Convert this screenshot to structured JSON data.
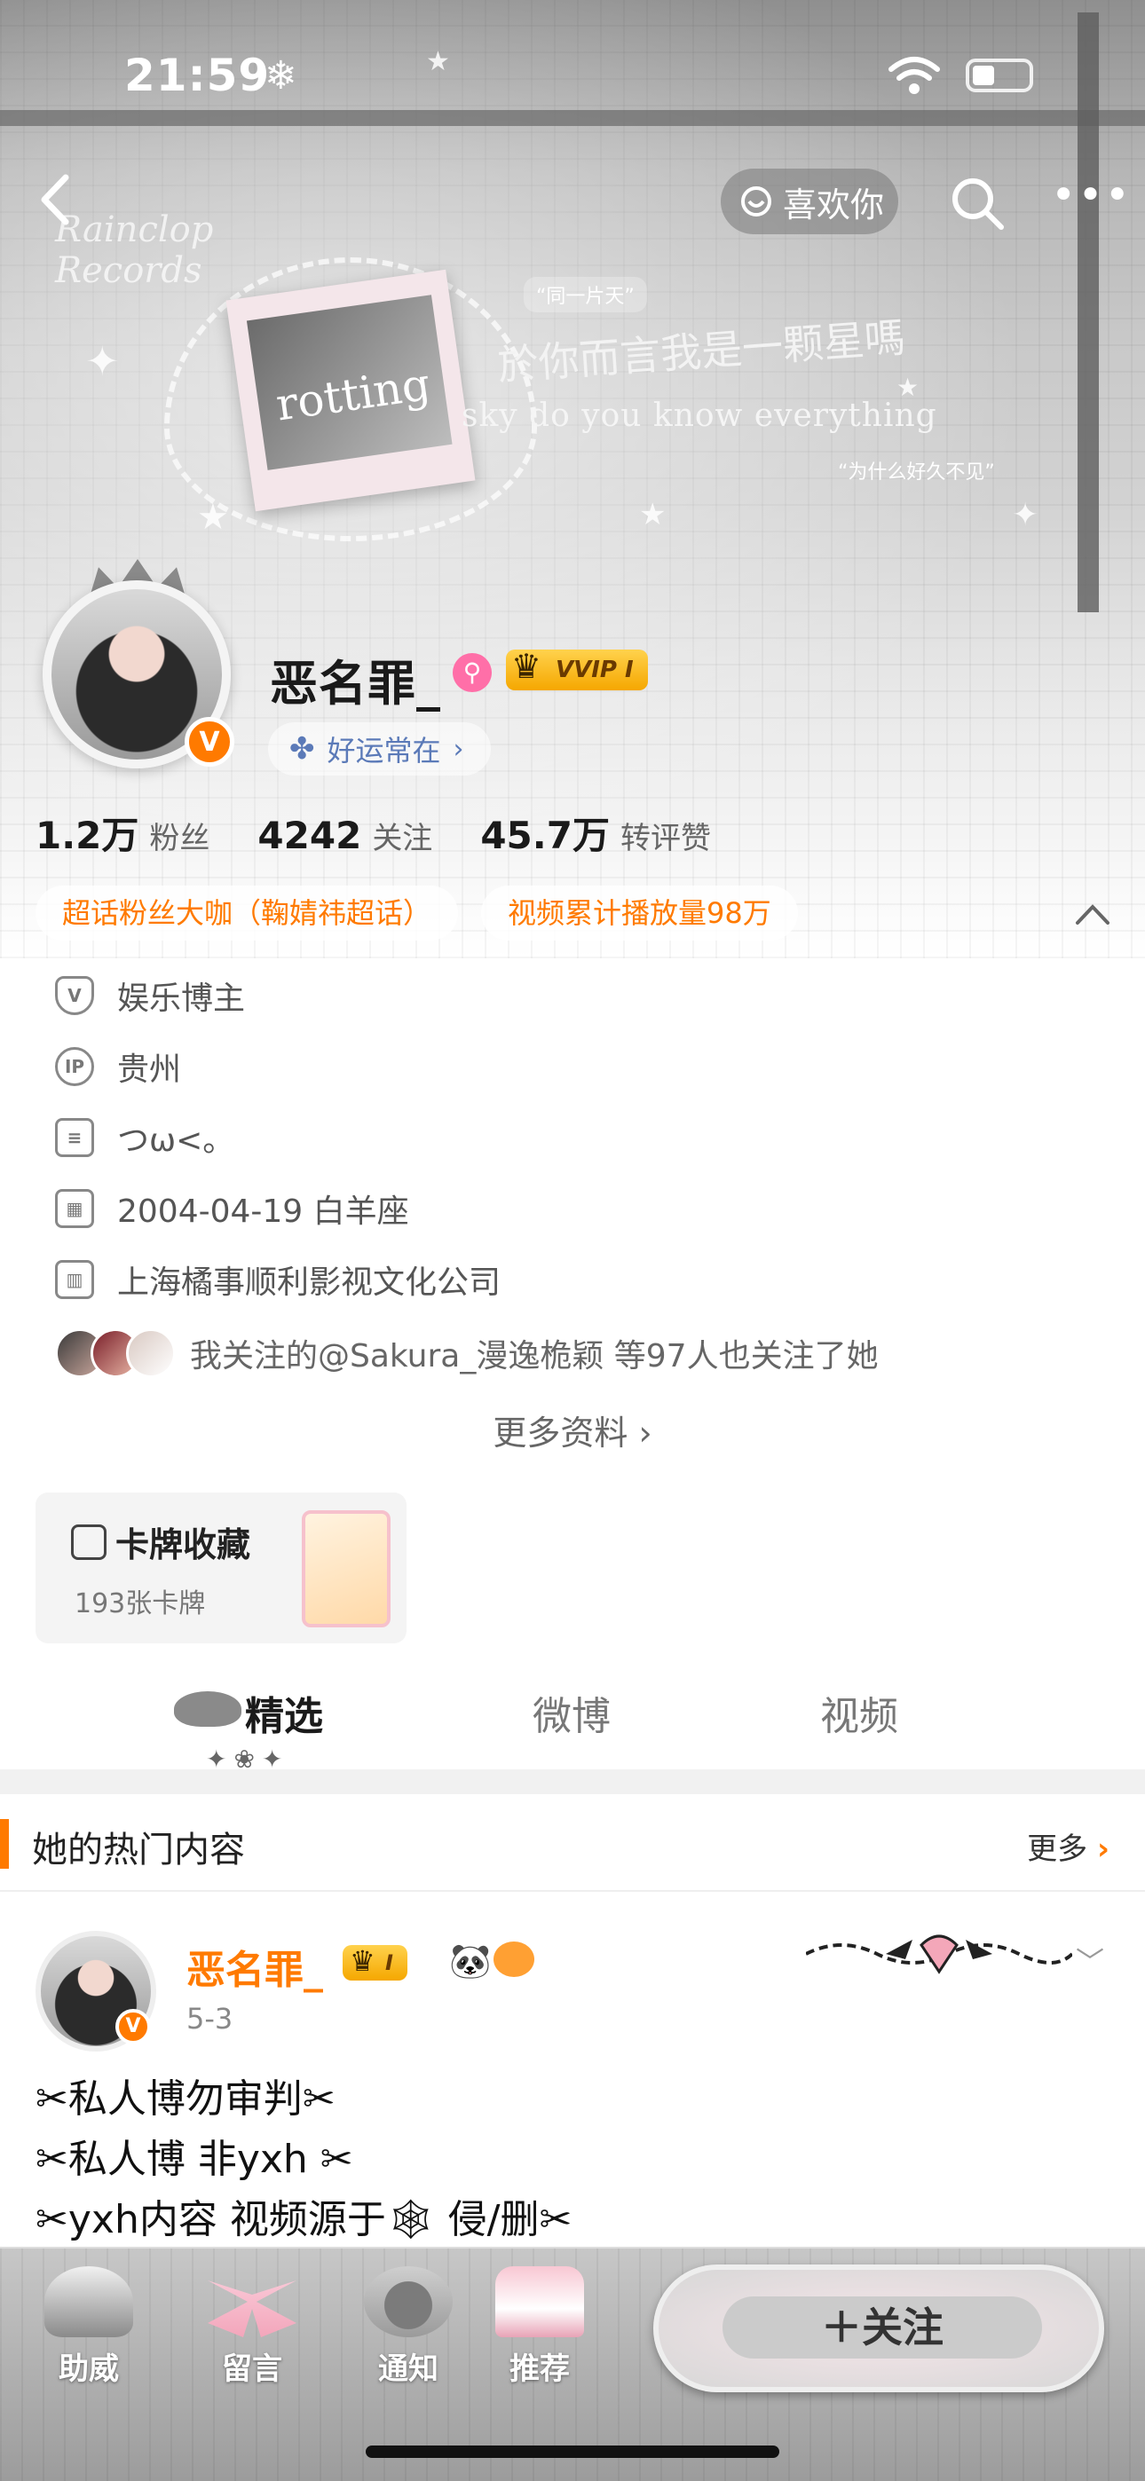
{
  "status_bar": {
    "time": "21:59",
    "weather_symbol": "❄"
  },
  "nav": {
    "like_label": "喜欢你"
  },
  "banner": {
    "polaroid_word": "rotting",
    "quote_top": "“同一片天”",
    "lyric_cn": "於你而言我是一颗星嗎",
    "lyric_en": "sky do you know everything",
    "quote_bottom": "“为什么好久不见”",
    "corner_script": "Rainclop Records"
  },
  "profile": {
    "username": "恶名罪_",
    "vip_label": "VVIP I",
    "verified_mark": "V",
    "luck_status": "好运常在",
    "stats": [
      {
        "value": "1.2万",
        "label": "粉丝"
      },
      {
        "value": "4242",
        "label": "关注"
      },
      {
        "value": "45.7万",
        "label": "转评赞"
      }
    ],
    "chips": [
      "超话粉丝大咖（鞠婧祎超话）",
      "视频累计播放量98万"
    ],
    "info": [
      {
        "icon": "verified-shield-icon",
        "text": "娱乐博主"
      },
      {
        "icon": "ip-location-icon",
        "text": "贵州"
      },
      {
        "icon": "bio-document-icon",
        "text": "つω<。"
      },
      {
        "icon": "calendar-icon",
        "text": "2004-04-19 白羊座"
      },
      {
        "icon": "company-building-icon",
        "text": "上海橘事顺利影视文化公司"
      }
    ],
    "mutual_followers": "我关注的@Sakura_漫逸桅颖 等97人也关注了她",
    "more_info": "更多资料"
  },
  "card_collection": {
    "title": "卡牌收藏",
    "count": "193张卡牌"
  },
  "tabs": [
    {
      "label": "精选",
      "active": true
    },
    {
      "label": "微博",
      "active": false
    },
    {
      "label": "视频",
      "active": false
    }
  ],
  "hot_section": {
    "title": "她的热门内容",
    "more": "更多"
  },
  "post": {
    "author": "恶名罪_",
    "vip_label": "I",
    "date": "5-3",
    "lines": [
      "✂私人博勿审判✂",
      "✂私人博 非yxh ✂",
      "✂yxh内容 视频源于🕸 侵/删✂"
    ]
  },
  "bottom_bar": {
    "items": [
      "助威",
      "留言",
      "通知",
      "推荐"
    ],
    "follow_label": "＋关注"
  },
  "colors": {
    "accent": "#ff7a00",
    "vip_gold": "#f5a700",
    "luck_blue": "#5b7ab8"
  }
}
